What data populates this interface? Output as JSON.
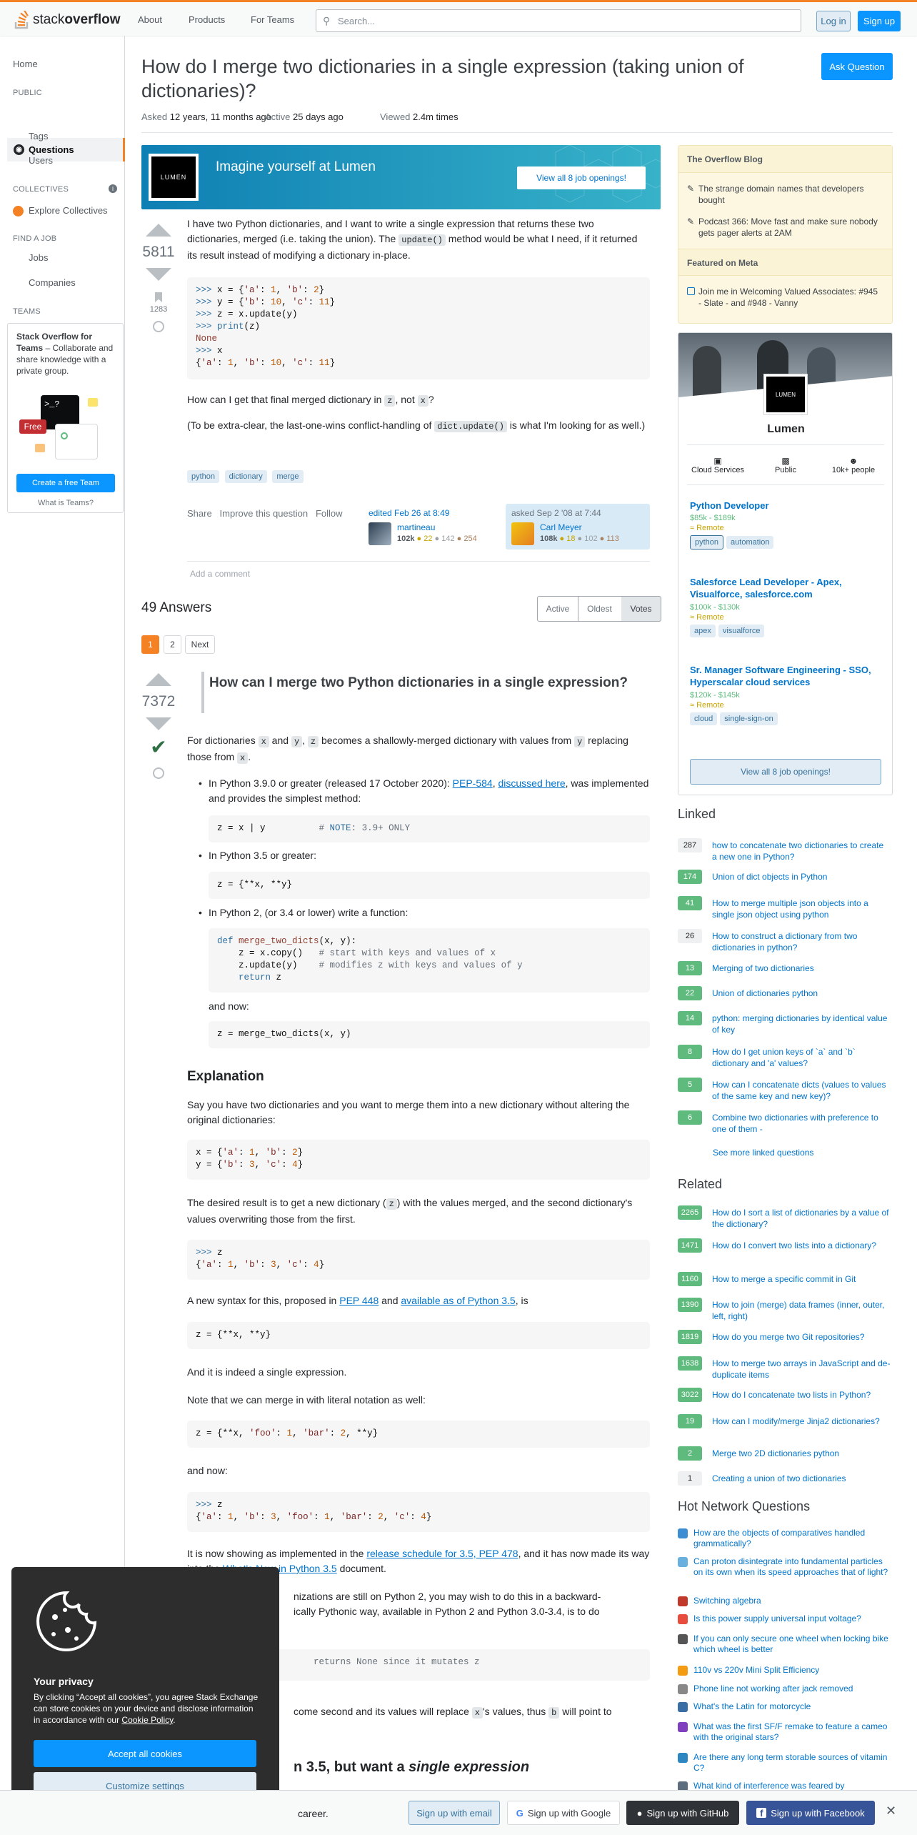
{
  "header": {
    "logo_light": "stack",
    "logo_bold": "overflow",
    "nav": [
      "About",
      "Products",
      "For Teams"
    ],
    "search_placeholder": "Search...",
    "login": "Log in",
    "signup": "Sign up"
  },
  "sidebar_left": {
    "home": "Home",
    "public": "PUBLIC",
    "questions": "Questions",
    "tags": "Tags",
    "users": "Users",
    "collectives": "COLLECTIVES",
    "explore": "Explore Collectives",
    "findajob": "FIND A JOB",
    "jobs": "Jobs",
    "companies": "Companies",
    "teams": "TEAMS",
    "team_title": "Stack Overflow for Teams",
    "team_desc": " – Collaborate and share knowledge with a private group.",
    "free": "Free",
    "create_team": "Create a free Team",
    "what_teams": "What is Teams?"
  },
  "question": {
    "title": "How do I merge two dictionaries in a single expression (taking union of dictionaries)?",
    "ask_button": "Ask Question",
    "asked_label": "Asked",
    "asked_value": "12 years, 11 months ago",
    "active_label": "Active",
    "active_value": "25 days ago",
    "viewed_label": "Viewed",
    "viewed_value": "2.4m times",
    "votes": "5811",
    "bookmarks": "1283",
    "p1_a": "I have two Python dictionaries, and I want to write a single expression that returns these two dictionaries, merged (i.e. taking the union). The ",
    "p1_code": "update()",
    "p1_b": " method would be what I need, if it returned its result instead of modifying a dictionary in-place.",
    "p2_a": "How can I get that final merged dictionary in ",
    "p2_z": "z",
    "p2_b": ", not ",
    "p2_x": "x",
    "p2_c": "?",
    "p3_a": "(To be extra-clear, the last-one-wins conflict-handling of ",
    "p3_code": "dict.update()",
    "p3_b": " is what I'm looking for as well.)",
    "tags": [
      "python",
      "dictionary",
      "merge"
    ],
    "menu": [
      "Share",
      "Improve this question",
      "Follow"
    ],
    "edited": "edited Feb 26 at 8:49",
    "editor": "martineau",
    "editor_rep": "102k",
    "editor_badges": [
      "● 22",
      "● 142",
      "● 254"
    ],
    "asked_card": "asked Sep 2 '08 at 7:44",
    "asker": "Carl Meyer",
    "asker_rep": "108k",
    "asker_badges": [
      "● 18",
      "● 102",
      "● 113"
    ],
    "add_comment": "Add a comment"
  },
  "banner": {
    "logo": "LUMEN",
    "text": "Imagine yourself at Lumen",
    "button": "View all 8 job openings!"
  },
  "answers": {
    "count": "49 Answers",
    "tabs": [
      "Active",
      "Oldest",
      "Votes"
    ],
    "pages": [
      "1",
      "2",
      "Next"
    ],
    "votes": "7372",
    "heading": "How can I merge two Python dictionaries in a single expression?",
    "intro_a": "For dictionaries ",
    "intro_x": "x",
    "intro_and": " and ",
    "intro_y": "y",
    "intro_comma": ", ",
    "intro_z": "z",
    "intro_b": " becomes a shallowly-merged dictionary with values from ",
    "intro_y2": "y",
    "intro_c": " replacing those from ",
    "intro_x2": "x",
    "intro_d": ".",
    "b1_a": "In Python 3.9.0 or greater (released 17 October 2020): ",
    "b1_link1": "PEP-584",
    "b1_sep": ", ",
    "b1_link2": "discussed here",
    "b1_b": ", was implemented and provides the simplest method:",
    "b2": "In Python 3.5 or greater:",
    "b3": "In Python 2, (or 3.4 or lower) write a function:",
    "and_now": "and now:",
    "explanation": "Explanation",
    "ex1": "Say you have two dictionaries and you want to merge them into a new dictionary without altering the original dictionaries:",
    "ex2_a": "The desired result is to get a new dictionary (",
    "ex2_z": "z",
    "ex2_b": ") with the values merged, and the second dictionary's values overwriting those from the first.",
    "ex3_a": "A new syntax for this, proposed in ",
    "ex3_link1": "PEP 448",
    "ex3_and": " and ",
    "ex3_link2": "available as of Python 3.5",
    "ex3_b": ", is",
    "ex4": "And it is indeed a single expression.",
    "ex5": "Note that we can merge in with literal notation as well:",
    "ex6": "and now:",
    "ex7_a": "It is now showing as implemented in the ",
    "ex7_link": "release schedule for 3.5, PEP 478",
    "ex7_b": ", and it has now made its way into the ",
    "ex7_link2": "What's New in Python 3.5",
    "ex7_c": " document.",
    "ex8": "However, since many organizations are still on Python 2, you may wish to do this in a backward-compatible way. The classically Pythonic way, available in Python 2 and Python 3.0-3.4, is to do this as a two-step process:",
    "ex8_visible_1": "nizations are still on Python 2, you may wish to do this in a backward-",
    "ex8_visible_2": "ically Pythonic way, available in Python 2 and Python 3.0-3.4, is to do",
    "code_tail": "returns None since it mutates z",
    "ex9_a": "come second and its values will replace ",
    "ex9_x": "x",
    "ex9_b": "'s values, thus ",
    "ex9_bb": "b",
    "ex9_c": " will point to",
    "h_tail_a": "n 3.5, but want a ",
    "h_tail_b": "single expression"
  },
  "blog": {
    "title": "The Overflow Blog",
    "items": [
      "The strange domain names that developers bought",
      "Podcast 366: Move fast and make sure nobody gets pager alerts at 2AM"
    ],
    "meta_title": "Featured on Meta",
    "meta_items": [
      "Join me in Welcoming Valued Associates: #945 - Slate - and #948 - Vanny"
    ]
  },
  "company": {
    "logo": "LUMEN",
    "name": "Lumen",
    "stats": [
      "Cloud Services",
      "Public",
      "10k+ people"
    ],
    "jobs": [
      {
        "title": "Python Developer",
        "salary": "$85k - $189k",
        "remote": "Remote",
        "tags": [
          "python",
          "automation"
        ]
      },
      {
        "title": "Salesforce Lead Developer - Apex, Visualforce, salesforce.com",
        "salary": "$100k - $130k",
        "remote": "Remote",
        "tags": [
          "apex",
          "visualforce"
        ]
      },
      {
        "title": "Sr. Manager Software Engineering - SSO, Hyperscalar cloud services",
        "salary": "$120k - $145k",
        "remote": "Remote",
        "tags": [
          "cloud",
          "single-sign-on"
        ]
      }
    ],
    "view_all": "View all 8 job openings!"
  },
  "linked": {
    "title": "Linked",
    "items": [
      {
        "n": "287",
        "t": "how to concatenate two dictionaries to create a new one in Python?",
        "acc": false
      },
      {
        "n": "174",
        "t": "Union of dict objects in Python",
        "acc": true
      },
      {
        "n": "41",
        "t": "How to merge multiple json objects into a single json object using python",
        "acc": true
      },
      {
        "n": "26",
        "t": "How to construct a dictionary from two dictionaries in python?",
        "acc": false
      },
      {
        "n": "13",
        "t": "Merging of two dictionaries",
        "acc": true
      },
      {
        "n": "22",
        "t": "Union of dictionaries python",
        "acc": true
      },
      {
        "n": "14",
        "t": "python: merging dictionaries by identical value of key",
        "acc": true
      },
      {
        "n": "8",
        "t": "How do I get union keys of `a` and `b` dictionary and 'a' values?",
        "acc": true
      },
      {
        "n": "5",
        "t": "How can I concatenate dicts (values to values of the same key and new key)?",
        "acc": true
      },
      {
        "n": "6",
        "t": "Combine two dictionaries with preference to one of them -",
        "acc": true
      }
    ],
    "more": "See more linked questions"
  },
  "related": {
    "title": "Related",
    "items": [
      {
        "n": "2265",
        "t": "How do I sort a list of dictionaries by a value of the dictionary?",
        "acc": true
      },
      {
        "n": "1471",
        "t": "How do I convert two lists into a dictionary?",
        "acc": true
      },
      {
        "n": "1160",
        "t": "How to merge a specific commit in Git",
        "acc": true
      },
      {
        "n": "1390",
        "t": "How to join (merge) data frames (inner, outer, left, right)",
        "acc": true
      },
      {
        "n": "1819",
        "t": "How do you merge two Git repositories?",
        "acc": true
      },
      {
        "n": "1638",
        "t": "How to merge two arrays in JavaScript and de-duplicate items",
        "acc": true
      },
      {
        "n": "3022",
        "t": "How do I concatenate two lists in Python?",
        "acc": true
      },
      {
        "n": "19",
        "t": "How can I modify/merge Jinja2 dictionaries?",
        "acc": true
      },
      {
        "n": "2",
        "t": "Merge two 2D dictionaries python",
        "acc": true
      },
      {
        "n": "1",
        "t": "Creating a union of two dictionaries",
        "acc": false
      }
    ]
  },
  "hnq": {
    "title": "Hot Network Questions",
    "items": [
      {
        "t": "How are the objects of comparatives handled grammatically?",
        "c": "#3c8dd1"
      },
      {
        "t": "Can proton disintegrate into fundamental particles on its own when its speed approaches that of light?",
        "c": "#6ab0de"
      },
      {
        "t": "Switching algebra",
        "c": "#c0392b"
      },
      {
        "t": "Is this power supply universal input voltage?",
        "c": "#e74c3c"
      },
      {
        "t": "If you can only secure one wheel when locking bike which wheel is better",
        "c": "#555555"
      },
      {
        "t": "110v vs 220v Mini Split Efficiency",
        "c": "#f39c12"
      },
      {
        "t": "Phone line not working after jack removed",
        "c": "#888888"
      },
      {
        "t": "What's the Latin for motorcycle",
        "c": "#3a6ea5"
      },
      {
        "t": "What was the first SF/F remake to feature a cameo with the original stars?",
        "c": "#7f3fbf"
      },
      {
        "t": "Are there any long term storable sources of vitamin C?",
        "c": "#2e86c1"
      },
      {
        "t": "What kind of interference was feared by",
        "c": "#5d6d7e"
      }
    ]
  },
  "cookie": {
    "title": "Your privacy",
    "desc": "By clicking “Accept all cookies”, you agree Stack Exchange can store cookies on your device and disclose information in accordance with our ",
    "policy": "Cookie Policy",
    "period": ".",
    "accept": "Accept all cookies",
    "customize": "Customize settings"
  },
  "signup_bar": {
    "text": "career.",
    "email": "Sign up with email",
    "google": "Sign up with Google",
    "github": "Sign up with GitHub",
    "facebook": "Sign up with Facebook"
  },
  "colors": {
    "accent": "#f48225",
    "link": "#0074cc",
    "primary": "#0a95ff",
    "accepted": "#2f6f44"
  }
}
